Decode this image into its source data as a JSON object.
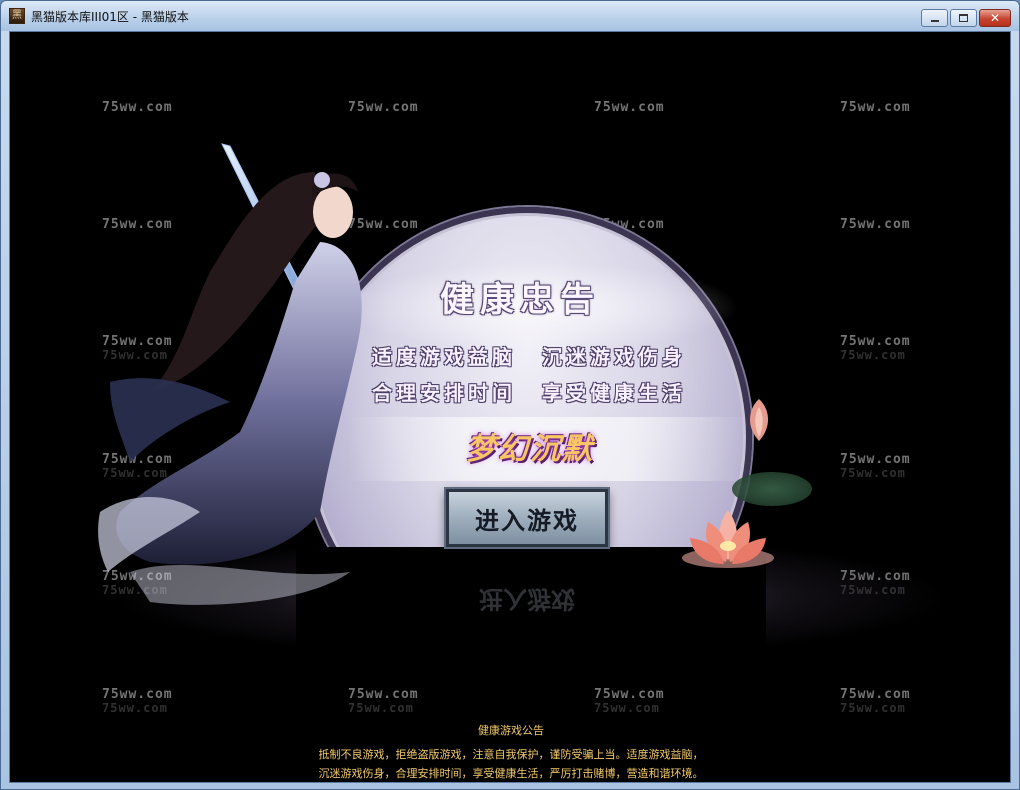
{
  "window": {
    "title": "黑猫版本库III01区 - 黑猫版本",
    "icon_char": "黑",
    "buttons": {
      "minimize": "minimize",
      "maximize": "maximize",
      "close": "✕"
    }
  },
  "watermark": {
    "text": "75ww.com"
  },
  "health_panel": {
    "heading": "健康忠告",
    "lines": [
      {
        "left": "适度游戏益脑",
        "right": "沉迷游戏伤身"
      },
      {
        "left": "合理安排时间",
        "right": "享受健康生活"
      }
    ],
    "game_logo": "梦幻沉默",
    "enter_button": "进入游戏"
  },
  "notice": {
    "title": "健康游戏公告",
    "line1": "抵制不良游戏，拒绝盗版游戏，注意自我保护，谨防受骗上当。适度游戏益脑，",
    "line2": "沉迷游戏伤身，合理安排时间，享受健康生活，严厉打击赌博，营造和谐环境。"
  },
  "colors": {
    "notice_text": "#f2c96a",
    "background": "#000000",
    "logo": "#f7c765"
  }
}
